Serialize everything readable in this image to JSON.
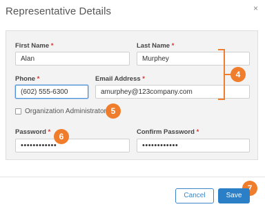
{
  "dialog": {
    "title": "Representative Details",
    "close_glyph": "×"
  },
  "form": {
    "first_name": {
      "label": "First Name",
      "required": "*",
      "value": "Alan"
    },
    "last_name": {
      "label": "Last Name",
      "required": "*",
      "value": "Murphey"
    },
    "phone": {
      "label": "Phone",
      "required": "*",
      "value": "(602) 555-6300"
    },
    "email": {
      "label": "Email Address",
      "required": "*",
      "value": "amurphey@123company.com"
    },
    "org_admin": {
      "label": "Organization Administrator",
      "checked": false
    },
    "password": {
      "label": "Password",
      "required": "*",
      "value": "••••••••••••"
    },
    "confirm_password": {
      "label": "Confirm Password",
      "required": "*",
      "value": "••••••••••••"
    }
  },
  "callouts": {
    "four": "4",
    "five": "5",
    "six": "6",
    "seven": "7"
  },
  "footer": {
    "cancel_label": "Cancel",
    "save_label": "Save"
  },
  "colors": {
    "accent_orange": "#ef7d2c",
    "primary_blue": "#2b7fc6",
    "required_red": "#d9302b"
  }
}
